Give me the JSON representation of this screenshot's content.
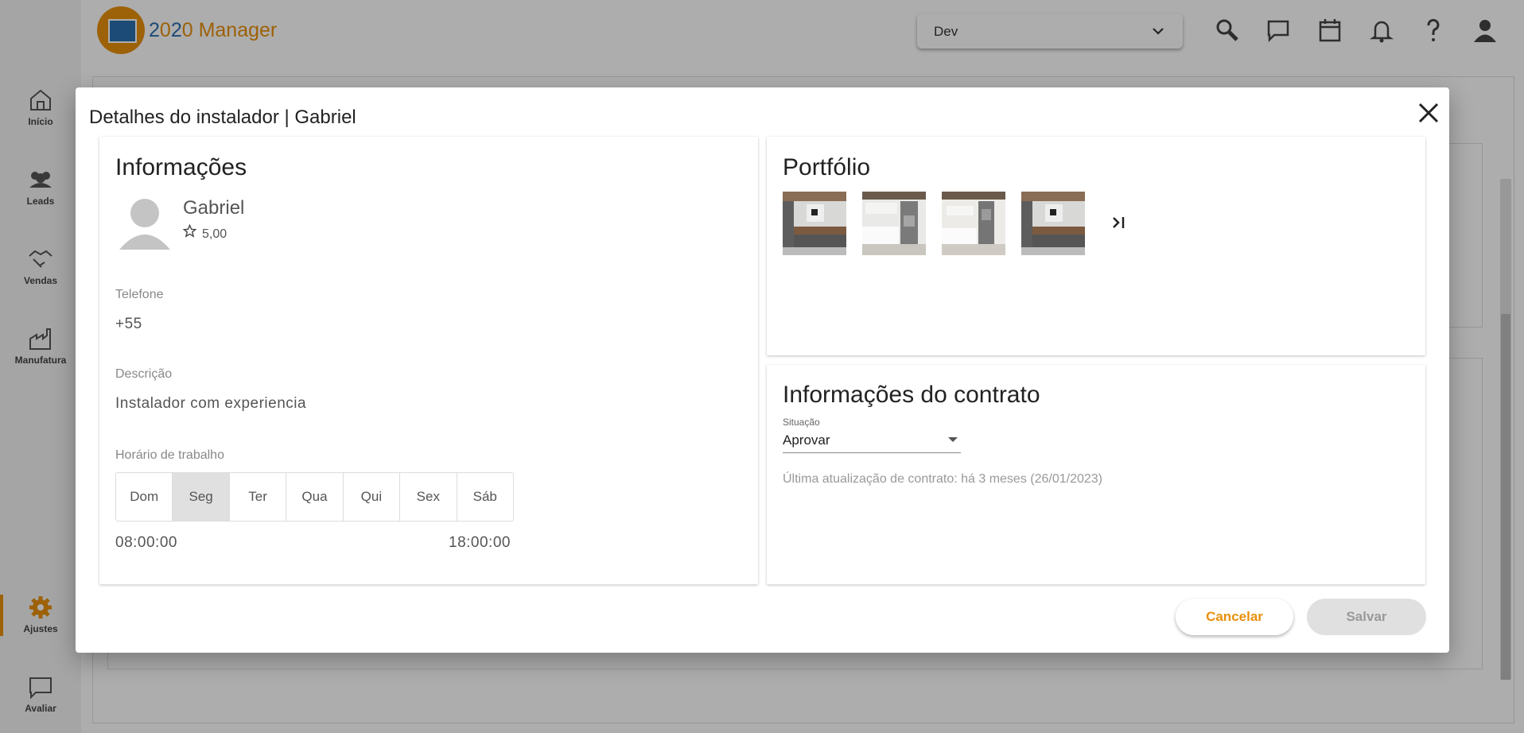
{
  "app": {
    "logo_text_a": "2",
    "logo_text_b": "0",
    "logo_text_c": "2",
    "logo_text_d": "0 Manager"
  },
  "env_select": {
    "value": "Dev"
  },
  "sidebar": {
    "items": [
      {
        "label": "Início",
        "icon": "home-icon"
      },
      {
        "label": "Leads",
        "icon": "users-icon"
      },
      {
        "label": "Vendas",
        "icon": "handshake-icon"
      },
      {
        "label": "Manufatura",
        "icon": "factory-icon"
      },
      {
        "label": "Ajustes",
        "icon": "gear-icon",
        "active": true
      },
      {
        "label": "Avaliar",
        "icon": "chat-icon"
      }
    ]
  },
  "topbar_icons": [
    "search-icon",
    "chat-icon",
    "calendar-icon",
    "bell-icon",
    "help-icon",
    "user-icon"
  ],
  "dialog": {
    "title": "Detalhes do instalador | Gabriel",
    "info": {
      "heading": "Informações",
      "name": "Gabriel",
      "rating": "5,00",
      "phone_label": "Telefone",
      "phone": "+55",
      "description_label": "Descrição",
      "description": "Instalador com experiencia",
      "schedule_label": "Horário de trabalho",
      "days": [
        "Dom",
        "Seg",
        "Ter",
        "Qua",
        "Qui",
        "Sex",
        "Sáb"
      ],
      "active_day": "Seg",
      "start_time": "08:00:00",
      "end_time": "18:00:00"
    },
    "portfolio": {
      "heading": "Portfólio",
      "images": [
        "bathroom",
        "kitchen",
        "kitchen",
        "bathroom"
      ]
    },
    "contract": {
      "heading": "Informações do contrato",
      "status_label": "Situação",
      "status_value": "Aprovar",
      "last_update": "Última atualização de contrato: há 3 meses (26/01/2023)"
    },
    "buttons": {
      "cancel": "Cancelar",
      "save": "Salvar"
    }
  },
  "colors": {
    "accent": "#e8900c",
    "logo_blue": "#2a6fb0"
  }
}
